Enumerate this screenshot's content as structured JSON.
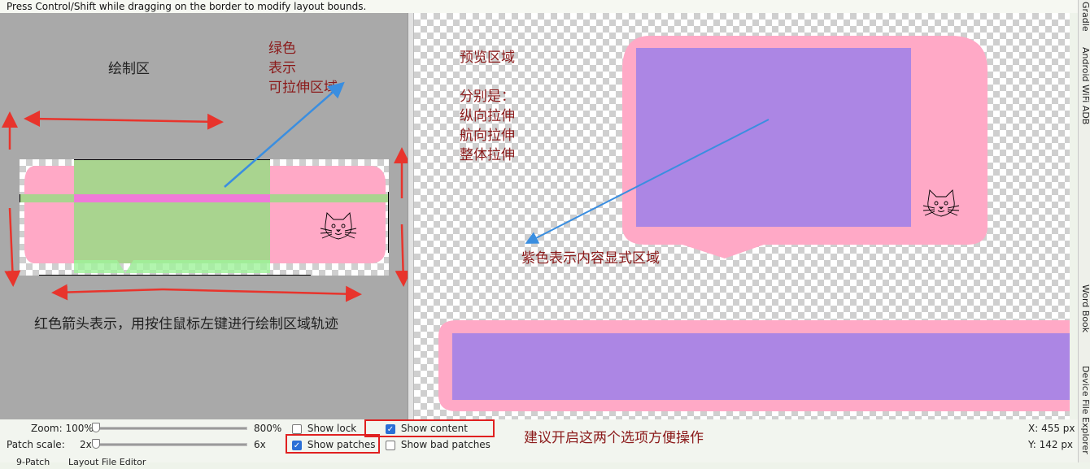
{
  "top_hint": "Press Control/Shift while dragging on the border to modify layout bounds.",
  "left_pane": {
    "draw_area_label": "绘制区",
    "green_note": [
      "绿色",
      "表示",
      "可拉伸区域"
    ],
    "red_arrow_note": "红色箭头表示，用按住鼠标左键进行绘制区域轨迹"
  },
  "right_pane": {
    "preview_note": [
      "预览区域",
      "",
      "分别是：",
      "纵向拉伸",
      "航向拉伸",
      "整体拉伸"
    ],
    "purple_note": "紫色表示内容显式区域"
  },
  "side_tabs": [
    "Gradle",
    "Android WiFi ADB",
    "Word Book",
    "Device File Explorer"
  ],
  "controls": {
    "zoom_label": "Zoom: 100%",
    "zoom_max": "800%",
    "zoom_value_fraction": 0.0,
    "patch_scale_label": "Patch scale:",
    "patch_scale_min": "2x",
    "patch_scale_max": "6x",
    "patch_scale_value_fraction": 0.0,
    "show_lock": {
      "label": "Show lock",
      "checked": false
    },
    "show_content": {
      "label": "Show content",
      "checked": true
    },
    "show_patches": {
      "label": "Show patches",
      "checked": true
    },
    "show_bad_patches": {
      "label": "Show bad patches",
      "checked": false
    },
    "suggest_note": "建议开启这两个选项方便操作",
    "coord_x": "X: 455 px",
    "coord_y": "Y: 142 px"
  },
  "bottom_tabs": [
    "9-Patch",
    "Layout File Editor"
  ],
  "colors": {
    "pink": "#ffa9c6",
    "green": "#a9d48f",
    "purple": "#ac86e4",
    "red_arrow": "#e8342c",
    "blue_arrow": "#3a8ee0",
    "annotation": "#8b1a1a"
  }
}
